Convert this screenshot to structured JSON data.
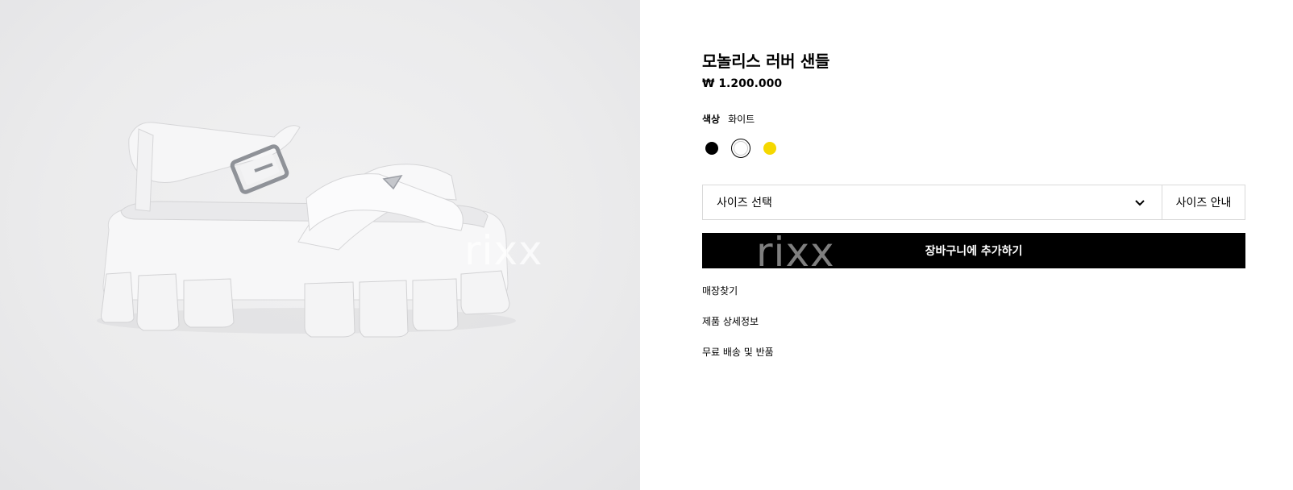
{
  "product": {
    "title": "모놀리스 러버 샌들",
    "price": "₩ 1.200.000",
    "image_alt": "white rubber platform sandal"
  },
  "color": {
    "label": "색상",
    "selected_value": "화이트",
    "swatches": [
      {
        "name": "black",
        "hex": "#000000",
        "selected": false
      },
      {
        "name": "white",
        "hex": "#ffffff",
        "selected": true
      },
      {
        "name": "yellow",
        "hex": "#f5d800",
        "selected": false
      }
    ]
  },
  "size": {
    "select_label": "사이즈 선택",
    "guide_label": "사이즈 안내"
  },
  "cart": {
    "button_label": "장바구니에 추가하기"
  },
  "links": [
    {
      "label": "매장찾기"
    },
    {
      "label": "제품 상세정보"
    },
    {
      "label": "무료 배송 및 반품"
    }
  ],
  "watermark": "rixx",
  "colors": {
    "button_bg": "#000000",
    "image_bg": "#ebebec",
    "border": "#d9d9d9"
  }
}
